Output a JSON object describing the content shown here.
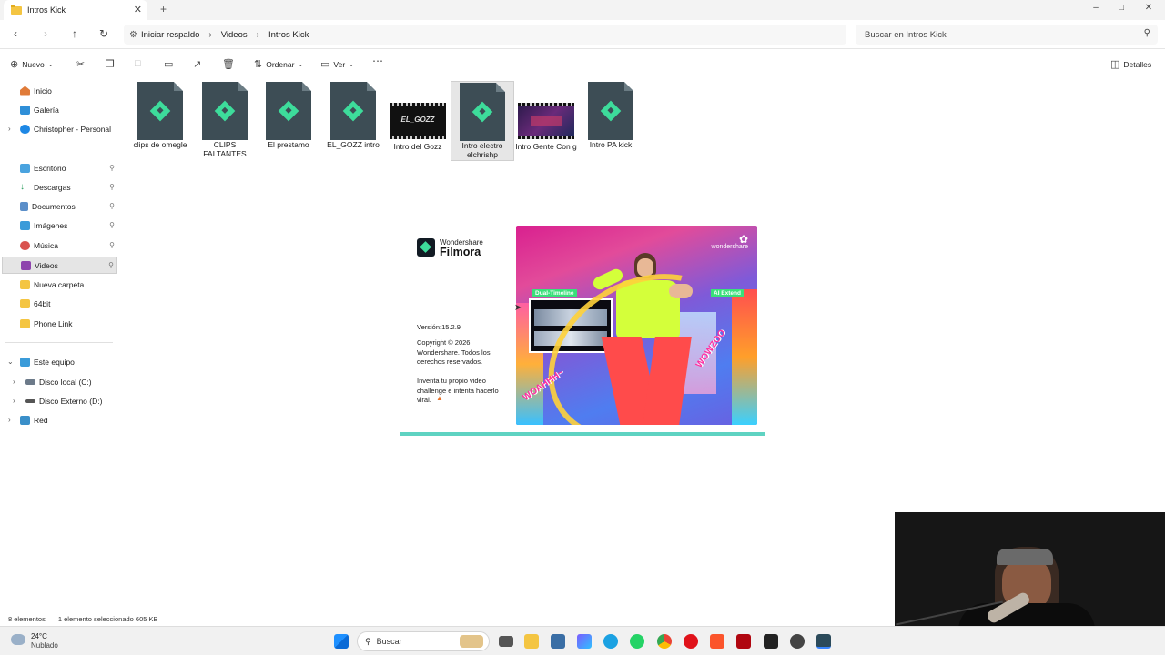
{
  "window": {
    "tab_title": "Intros Kick",
    "close_label": "✕",
    "add_label": "+"
  },
  "address": {
    "crumbs": [
      "Iniciar respaldo",
      "Videos",
      "Intros Kick"
    ],
    "search_placeholder": "Buscar en Intros Kick"
  },
  "toolbar": {
    "new_label": "Nuevo",
    "sort_label": "Ordenar",
    "view_label": "Ver",
    "details_label": "Detalles"
  },
  "sidebar": {
    "items": [
      {
        "label": "Inicio",
        "icon": "home-icon"
      },
      {
        "label": "Galería",
        "icon": "gallery-icon"
      },
      {
        "label": "Christopher - Personal",
        "icon": "onedrive-icon"
      },
      {
        "label": "Escritorio",
        "icon": "desktop-icon"
      },
      {
        "label": "Descargas",
        "icon": "download-icon"
      },
      {
        "label": "Documentos",
        "icon": "documents-icon"
      },
      {
        "label": "Imágenes",
        "icon": "images-icon"
      },
      {
        "label": "Música",
        "icon": "music-icon"
      },
      {
        "label": "Videos",
        "icon": "videos-icon"
      },
      {
        "label": "Nueva carpeta",
        "icon": "folder-icon"
      },
      {
        "label": "64bit",
        "icon": "folder-icon"
      },
      {
        "label": "Phone Link",
        "icon": "folder-icon"
      },
      {
        "label": "Este equipo",
        "icon": "pc-icon"
      },
      {
        "label": "Disco local (C:)",
        "icon": "drive-icon"
      },
      {
        "label": "Disco Externo (D:)",
        "icon": "drive-icon"
      },
      {
        "label": "Red",
        "icon": "network-icon"
      }
    ]
  },
  "files": [
    {
      "name": "clips de omegle",
      "type": "filmora"
    },
    {
      "name": "CLIPS FALTANTES",
      "type": "filmora"
    },
    {
      "name": "El prestamo",
      "type": "filmora"
    },
    {
      "name": "EL_GOZZ intro",
      "type": "filmora"
    },
    {
      "name": "Intro del Gozz",
      "type": "video",
      "thumb_text": "EL_GOZZ"
    },
    {
      "name": "Intro electro elchrishp",
      "type": "filmora",
      "selected": true
    },
    {
      "name": "Intro Gente Con g",
      "type": "video"
    },
    {
      "name": "Intro PA kick",
      "type": "filmora"
    }
  ],
  "splash": {
    "brand_top": "Wondershare",
    "brand_main": "Filmora",
    "version": "Versión:15.2.9",
    "copyright": "Copyright © 2026 Wondershare. Todos los derechos reservados.",
    "tagline": "Inventa tu propio video challenge e intenta hacerlo viral.",
    "image_brand": "wondershare",
    "label_dual": "Dual-Timeline",
    "label_ai": "AI Extend",
    "label_left": "WOAHHH~",
    "label_right": "WOWZOO",
    "progress": 1.0
  },
  "status": {
    "count": "8 elementos",
    "selection": "1 elemento seleccionado  605 KB"
  },
  "taskbar": {
    "weather_temp": "24°C",
    "weather_desc": "Nublado",
    "search_label": "Buscar"
  },
  "colors": {
    "filmora_green": "#3ddc9b",
    "progress": "#5fd3c2"
  }
}
